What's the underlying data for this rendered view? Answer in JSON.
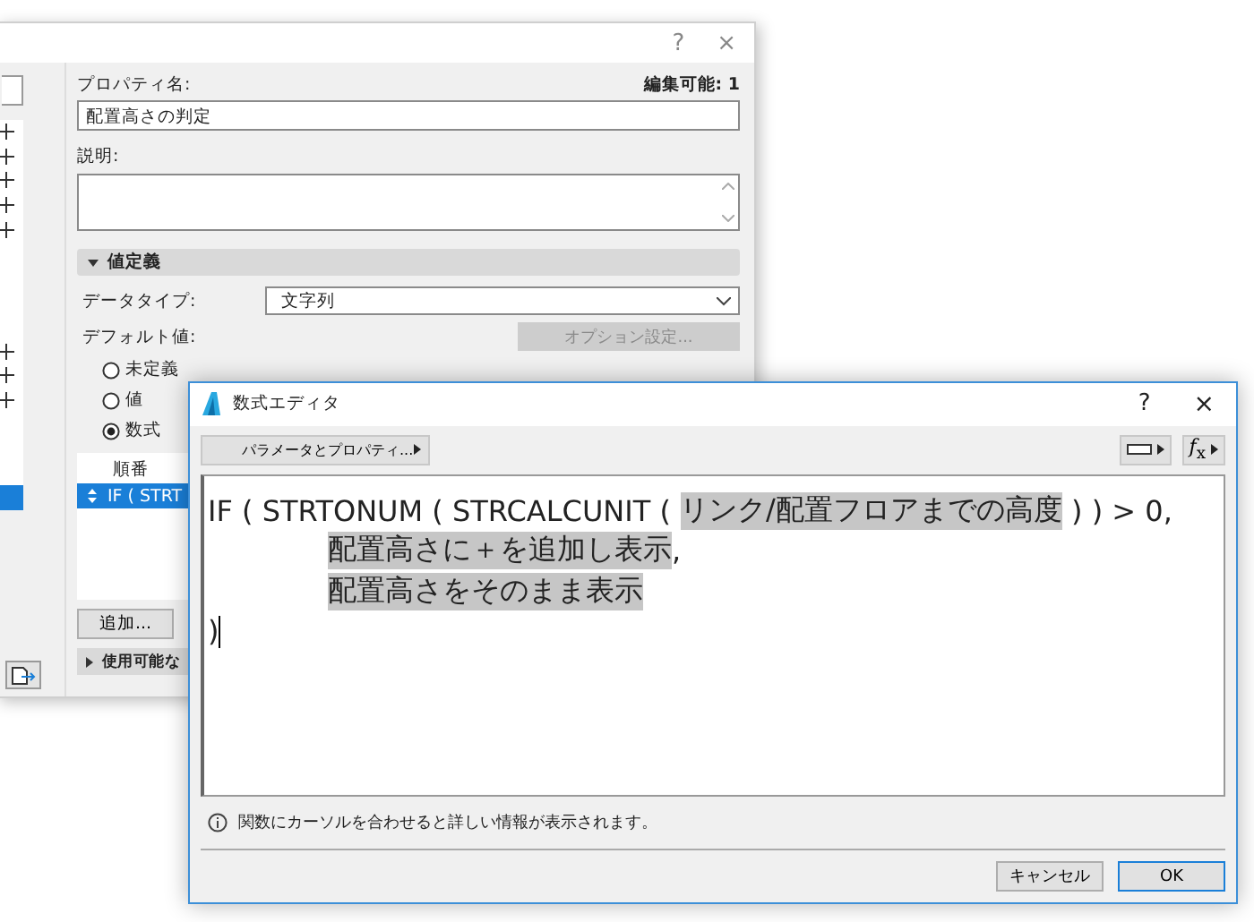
{
  "back_window": {
    "help": "?",
    "close": "×",
    "left_panel": {
      "rows": [
        {
          "kind": "group",
          "selected": false
        },
        {
          "kind": "group",
          "selected": false
        },
        {
          "kind": "group",
          "selected": false
        },
        {
          "kind": "group",
          "selected": false
        },
        {
          "kind": "group",
          "selected": false
        },
        {
          "kind": "plain",
          "selected": false
        },
        {
          "kind": "plain",
          "selected": false
        },
        {
          "kind": "plain",
          "selected": false
        },
        {
          "kind": "plain",
          "selected": false
        },
        {
          "kind": "group",
          "selected": false
        },
        {
          "kind": "group",
          "selected": false
        },
        {
          "kind": "group",
          "selected": false
        },
        {
          "kind": "plain",
          "selected": false
        },
        {
          "kind": "plain",
          "selected": false
        },
        {
          "kind": "plain",
          "selected": false
        },
        {
          "kind": "plain",
          "selected": true
        }
      ]
    },
    "property_name_label": "プロパティ名:",
    "editable": "編集可能: 1",
    "property_name": "配置高さの判定",
    "description_label": "説明:",
    "value_section": {
      "title": "値定義",
      "expanded": true
    },
    "data_type_label": "データタイプ:",
    "data_type": "文字列",
    "default_label": "デフォルト値:",
    "option_button": {
      "label": "オプション設定...",
      "disabled": true
    },
    "radios": [
      {
        "label": "未定義",
        "selected": false
      },
      {
        "label": "値",
        "selected": false
      },
      {
        "label": "数式",
        "selected": true
      }
    ],
    "table": {
      "header": "順番",
      "rows": [
        {
          "text": "IF ( STRT",
          "selected": true
        }
      ]
    },
    "add_button": "追加...",
    "usable_section": {
      "title": "使用可能な",
      "expanded": false
    }
  },
  "formula_editor": {
    "title": "数式エディタ",
    "help": "?",
    "close": "×",
    "params_button": "パラメータとプロパティ...",
    "function_button": "*f*$_{x}$",
    "lines": [
      {
        "indented": false,
        "segments": [
          {
            "text": "IF ( STRTONUM ( STRCALCUNIT ( ",
            "highlighted": false
          },
          {
            "text": "リンク/配置フロアまでの高度",
            "highlighted": true
          },
          {
            "text": " ) ) > 0,",
            "highlighted": false
          }
        ]
      },
      {
        "indented": true,
        "segments": [
          {
            "text": "配置高さに＋を追加し表示",
            "highlighted": true
          },
          {
            "text": ",",
            "highlighted": false
          }
        ]
      },
      {
        "indented": true,
        "segments": [
          {
            "text": "配置高さをそのまま表示",
            "highlighted": true
          }
        ]
      },
      {
        "indented": false,
        "caret": true,
        "segments": [
          {
            "text": ")",
            "highlighted": false
          }
        ]
      }
    ],
    "info": "関数にカーソルを合わせると詳しい情報が表示されます。",
    "buttons": [
      {
        "label": "キャンセル",
        "default": false
      },
      {
        "label": "OK",
        "default": true
      }
    ]
  }
}
